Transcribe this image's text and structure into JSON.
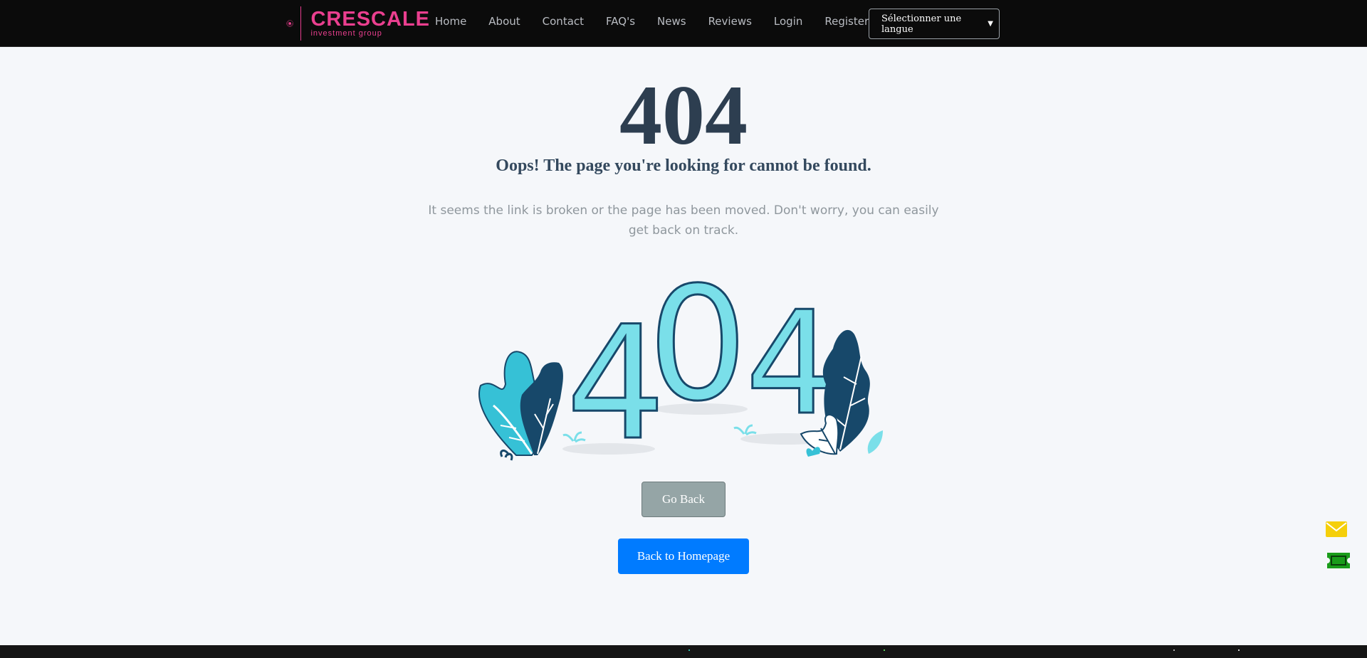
{
  "header": {
    "logo": {
      "name": "CRESCALE",
      "tagline": "investment group",
      "brand_color": "#ea3f8f"
    },
    "nav": [
      {
        "label": "Home"
      },
      {
        "label": "About"
      },
      {
        "label": "Contact"
      },
      {
        "label": "FAQ's"
      },
      {
        "label": "News"
      },
      {
        "label": "Reviews"
      },
      {
        "label": "Login"
      },
      {
        "label": "Register"
      }
    ],
    "language_select": {
      "value": "Sélectionner une langue"
    }
  },
  "main": {
    "code": "404",
    "title": "Oops! The page you're looking for cannot be found.",
    "description": "It seems the link is broken or the page has been moved. Don't worry, you can easily get back on track.",
    "illustration_text": [
      "4",
      "0",
      "4"
    ],
    "go_back_label": "Go Back",
    "home_label": "Back to Homepage"
  },
  "floating": {
    "mail_icon": "envelope-icon",
    "mail_color": "#f5cf0a",
    "ticket_icon": "ticket-icon",
    "ticket_color": "#1a9c1a"
  },
  "colors": {
    "heading": "#2d3e50",
    "primary_button": "#007bff",
    "secondary_button": "#95a5a6",
    "illus_light": "#7adfe9",
    "illus_dark": "#17486a"
  }
}
